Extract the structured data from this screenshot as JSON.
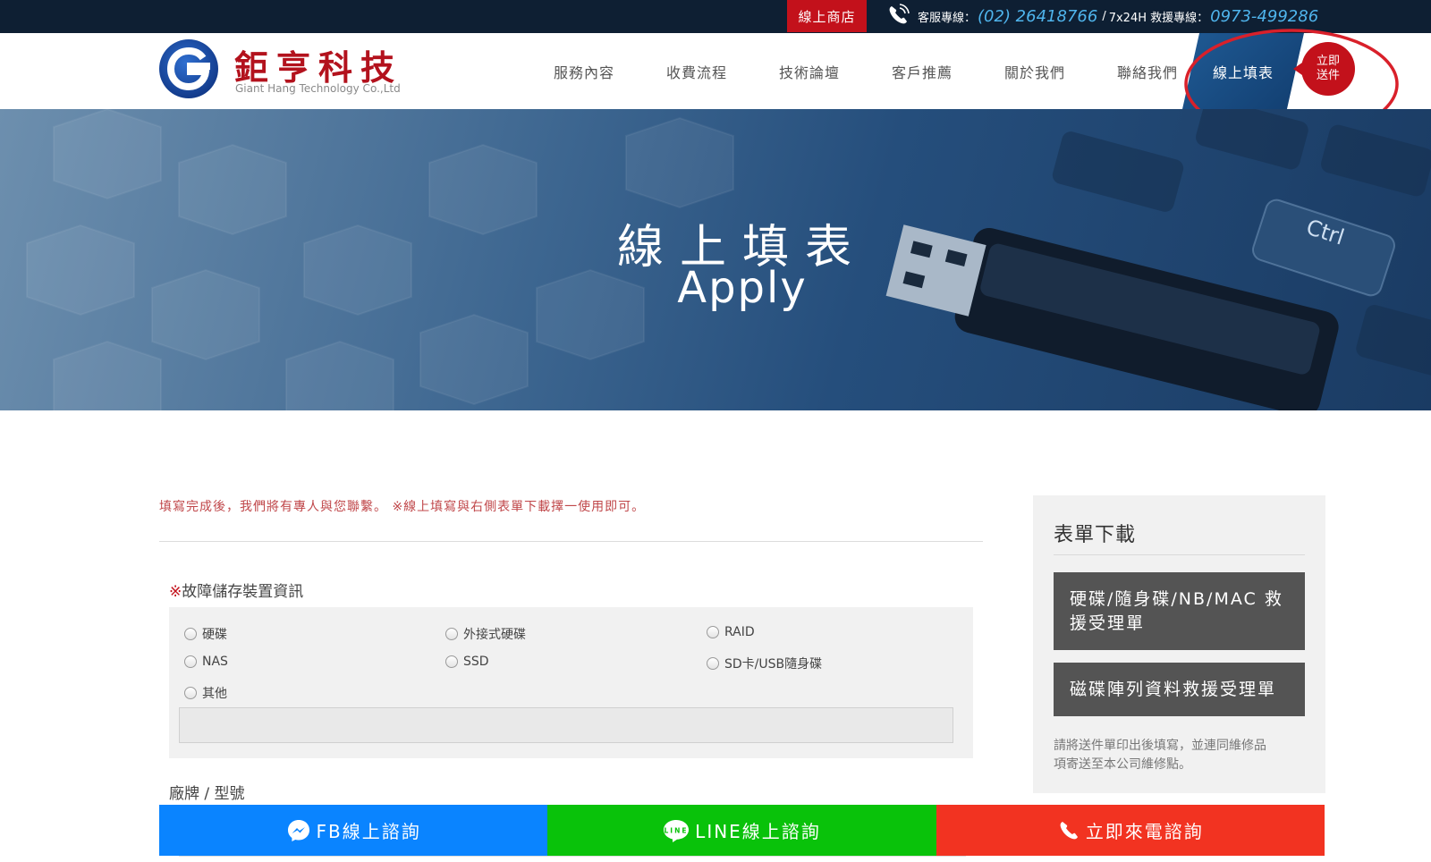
{
  "topbar": {
    "shop_label": "線上商店",
    "service_label": "客服專線：",
    "service_number": "(02) 26418766",
    "separator": "/",
    "rescue_label": "7x24H 救援專線：",
    "rescue_number": "0973-499286"
  },
  "header": {
    "logo_cn": "鉅亨科技",
    "logo_en": "Giant Hang Technology Co.,Ltd",
    "nav": [
      "服務內容",
      "收費流程",
      "技術論壇",
      "客戶推薦",
      "關於我們",
      "聯絡我們"
    ],
    "active_nav": "線上填表",
    "send_bubble_line1": "立即",
    "send_bubble_line2": "送件"
  },
  "hero": {
    "title_cn": "線上填表",
    "title_en": "Apply"
  },
  "form": {
    "notice": "填寫完成後，我們將有專人與您聯繫。 ※線上填寫與右側表單下載擇一使用即可。",
    "section_star": "※",
    "section_title": "故障儲存裝置資訊",
    "options": [
      "硬碟",
      "外接式硬碟",
      "RAID",
      "NAS",
      "SSD",
      "SD卡/USB隨身碟",
      "其他"
    ],
    "brand_label": "廠牌 / 型號"
  },
  "sidebar": {
    "title": "表單下載",
    "btn1_line1": "硬碟/隨身碟/NB/MAC 救",
    "btn1_line2": "援受理單",
    "btn2": "磁碟陣列資料救援受理單",
    "note_line1": "請將送件單印出後填寫，並連同維修品",
    "note_line2": "項寄送至本公司維修點。"
  },
  "contact_bar": {
    "fb": "FB線上諮詢",
    "line": "LINE線上諮詢",
    "call": "立即來電諮詢"
  },
  "colors": {
    "brand_red": "#c3111b",
    "nav_blue": "#1f5a94",
    "phone_blue": "#4fb4ec",
    "fb_blue": "#0a84ff",
    "line_green": "#09c20a",
    "call_red": "#f23321"
  },
  "icons": [
    "phone-icon",
    "logo-mark-icon",
    "messenger-icon",
    "line-icon",
    "phone-handset-icon"
  ]
}
